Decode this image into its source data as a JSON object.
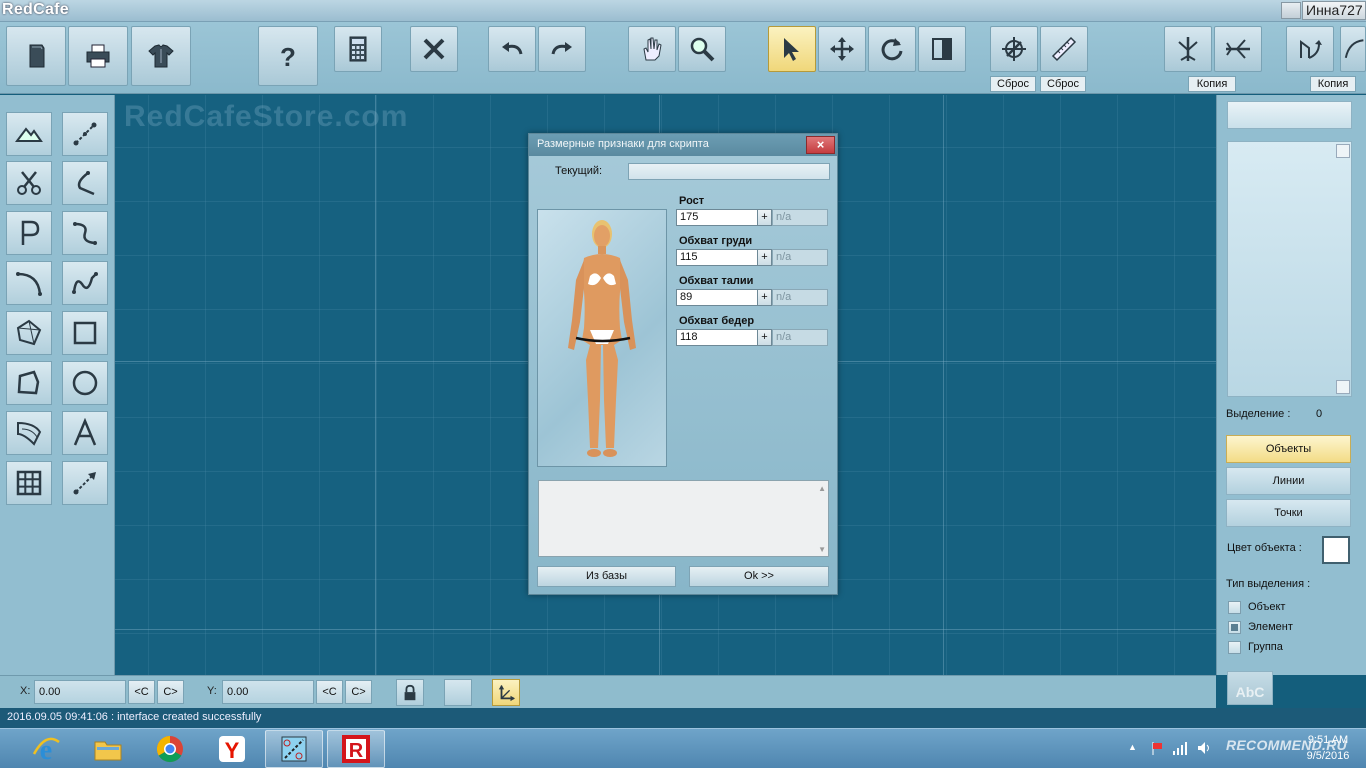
{
  "app": {
    "title": "RedCafe",
    "user": "Инна727",
    "watermark": "RedCafeStore.com"
  },
  "toolbar": {
    "labels": {
      "reset1": "Сброс",
      "reset2": "Сброс",
      "copy1": "Копия",
      "copy2": "Копия"
    }
  },
  "dialog": {
    "title": "Размерные признаки для скрипта",
    "close": "×",
    "current_label": "Текущий:",
    "current_value": "",
    "fields": [
      {
        "label": "Рост",
        "value": "175",
        "plus": "+",
        "na": "n/a"
      },
      {
        "label": "Обхват груди",
        "value": "115",
        "plus": "+",
        "na": "n/a"
      },
      {
        "label": "Обхват талии",
        "value": "89",
        "plus": "+",
        "na": "n/a"
      },
      {
        "label": "Обхват бедер",
        "value": "118",
        "plus": "+",
        "na": "n/a"
      }
    ],
    "btn_from_db": "Из базы",
    "btn_ok": "Ok >>"
  },
  "right_panel": {
    "selection_label": "Выделение :",
    "selection_count": "0",
    "btn_objects": "Объекты",
    "btn_lines": "Линии",
    "btn_points": "Точки",
    "color_label": "Цвет объекта :",
    "color_value": "#ffffff",
    "select_type_label": "Тип выделения :",
    "select_types": [
      {
        "label": "Объект",
        "checked": false
      },
      {
        "label": "Элемент",
        "checked": true
      },
      {
        "label": "Группа",
        "checked": false
      }
    ],
    "abc_icon": "AbC"
  },
  "coords": {
    "x_label": "X:",
    "x_value": "0.00",
    "y_label": "Y:",
    "y_value": "0.00",
    "prev": "<C",
    "next": "C>"
  },
  "status": {
    "message": "2016.09.05 09:41:06 : interface created successfully"
  },
  "taskbar": {
    "time": "9:51 AM",
    "date": "9/5/2016",
    "tray_arrow": "▲",
    "watermark": "RECOMMEND.RU"
  }
}
